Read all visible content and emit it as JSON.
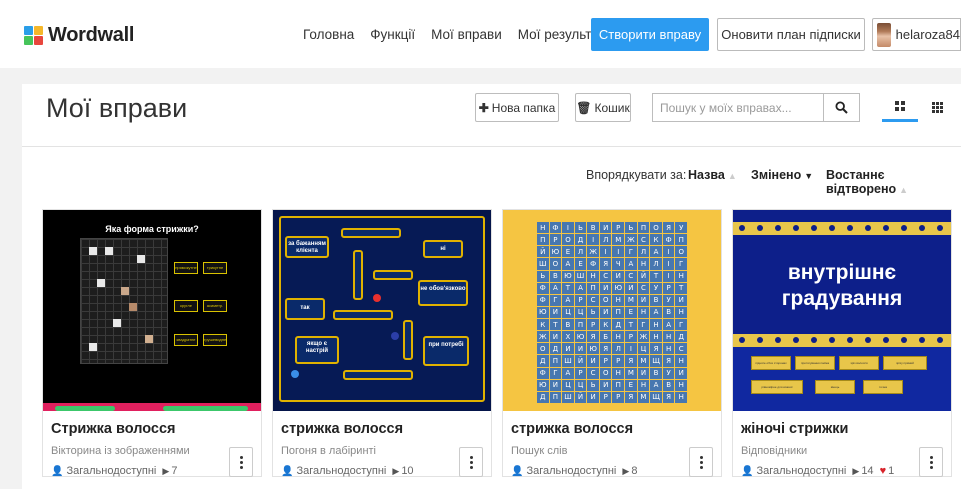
{
  "header": {
    "logo_text": "Wordwall",
    "nav": [
      "Головна",
      "Функції",
      "Мої вправи",
      "Мої результати"
    ],
    "create_label": "Створити вправу",
    "upgrade_label": "Оновити план підписки",
    "username": "helaroza84"
  },
  "page": {
    "title": "Мої вправи",
    "new_folder_label": "Нова папка",
    "trash_label": "Кошик",
    "search_placeholder": "Пошук у моїх вправах...",
    "sort_label": "Впорядкувати за:",
    "sort_options": [
      "Назва",
      "Змінено",
      "Востаннє відтворено"
    ],
    "active_sort": "Змінено"
  },
  "cards": [
    {
      "title": "Стрижка волосся",
      "type": "Вікторина із зображеннями",
      "visibility": "Загальнодоступні",
      "plays": "7",
      "likes": ""
    },
    {
      "title": "стрижка волосся",
      "type": "Погоня в лабіринті",
      "visibility": "Загальнодоступні",
      "plays": "10",
      "likes": ""
    },
    {
      "title": "стрижка волосся",
      "type": "Пошук слів",
      "visibility": "Загальнодоступні",
      "plays": "8",
      "likes": ""
    },
    {
      "title": "жіночі стрижки",
      "type": "Відповідники",
      "visibility": "Загальнодоступні",
      "plays": "14",
      "likes": "1"
    }
  ],
  "thumbs": {
    "quiz_question": "Яка форма стрижки?",
    "quiz_options": [
      "прямокутне",
      "трикутне",
      "кругле",
      "асиметр.",
      "квадратне",
      "грушевидне"
    ],
    "maze_labels": [
      "за бажанням клієнта",
      "ні",
      "не обов'язково",
      "так",
      "якщо є настрій",
      "при потребі"
    ],
    "wordsearch_rows": [
      "НФІЬВИРЬПОЯУ",
      "ПРОДІЛМЖСКФП",
      "ЙЮЕЛЖІІГЛАІО",
      "ШОАЕФЯЧАНЛІГ",
      "ЬВЮШНСИСЙТІН",
      "ФАТАПИЮИСУРТ",
      "ФГАРСОНМИВУИ",
      "ЮИЦЦЬИПЕНАВН",
      "КТВПРКДТГНАГ",
      "ЖИХЮЯБНРЖННД",
      "ОДИИЮЯЛІЦЯНС",
      "ДПШЙИРРЯМЩЯН",
      "ФГАРСОНМИВУИ",
      "ЮИЦЦЬИПЕНАВН",
      "ДПШЙИРРЯМЩЯН"
    ],
    "quizshow_title": "внутрішнє градування",
    "quizshow_answers": [
      "підняте обох сторонах",
      "протягування пасма",
      "зріз волосся",
      "зрізу прямий",
      "рівномірне для кожної",
      "кінець",
      "точна"
    ]
  },
  "colors": {
    "accent": "#2c9bf0",
    "heart": "#d8232a"
  }
}
